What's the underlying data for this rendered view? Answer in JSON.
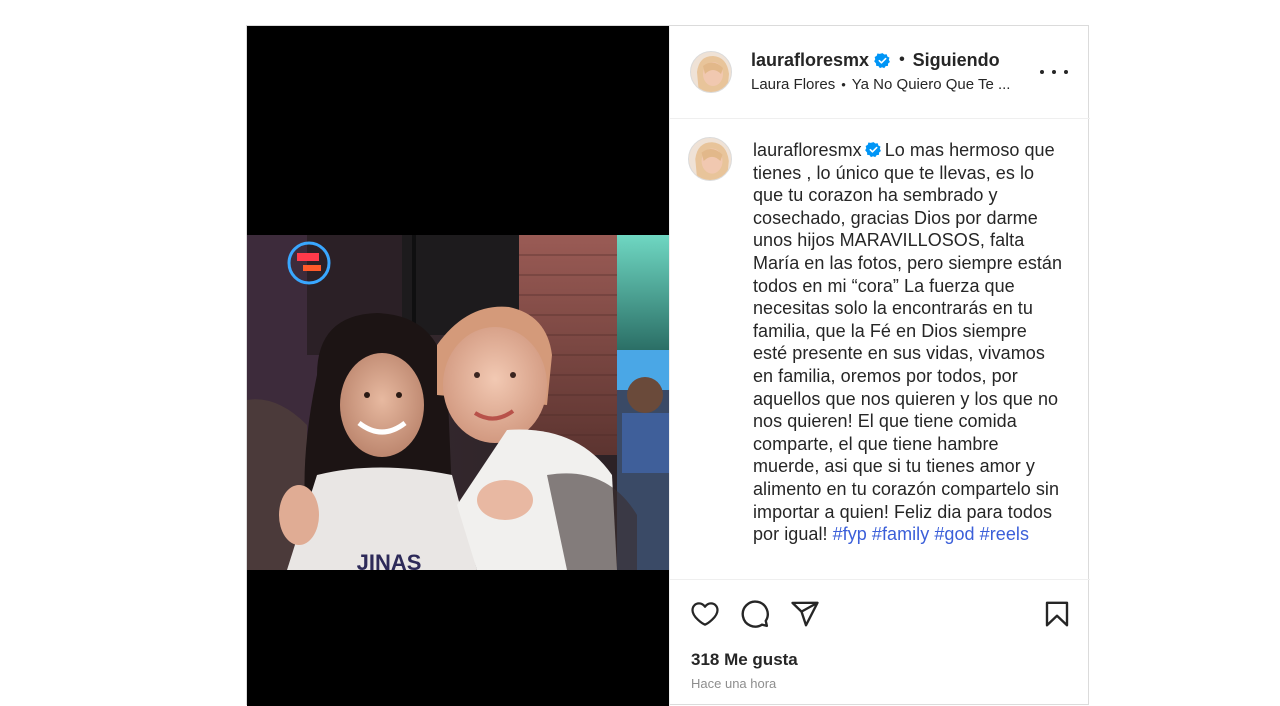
{
  "header": {
    "username": "laurafloresmx",
    "separator": "•",
    "follow_status": "Siguiendo",
    "author_name": "Laura Flores",
    "audio_separator": "•",
    "audio_title": "Ya No Quiero Que Te ..."
  },
  "caption": {
    "username": "laurafloresmx",
    "text": "Lo mas hermoso que tienes , lo único que te llevas, es lo que tu corazon ha sembrado y cosechado, gracias Dios por darme unos hijos MARAVILLOSOS, falta María en las fotos, pero siempre están todos en mi “cora” La fuerza que necesitas solo la encontrarás en tu familia, que la Fé en Dios siempre esté presente en sus vidas, vivamos en familia, oremos por todos, por aquellos que nos quieren y los que no nos quieren! El que tiene comida comparte, el que tiene hambre muerde, asi que si tu tienes amor y alimento en tu corazón compartelo sin importar a quien! Feliz dia para todos por igual!",
    "hashtags": [
      "#fyp",
      "#family",
      "#god",
      "#reels"
    ]
  },
  "photo": {
    "shirt_text": "JINAS"
  },
  "engagement": {
    "likes": "318 Me gusta",
    "time": "Hace una hora"
  },
  "icons": {
    "verified": "verified-badge-icon",
    "more": "more-options-icon",
    "like": "heart-icon",
    "comment": "comment-icon",
    "share": "share-icon",
    "save": "bookmark-icon"
  },
  "colors": {
    "verified": "#0095f6",
    "hashtag": "#3b5fd9",
    "text": "#262626",
    "muted": "#8e8e8e"
  }
}
